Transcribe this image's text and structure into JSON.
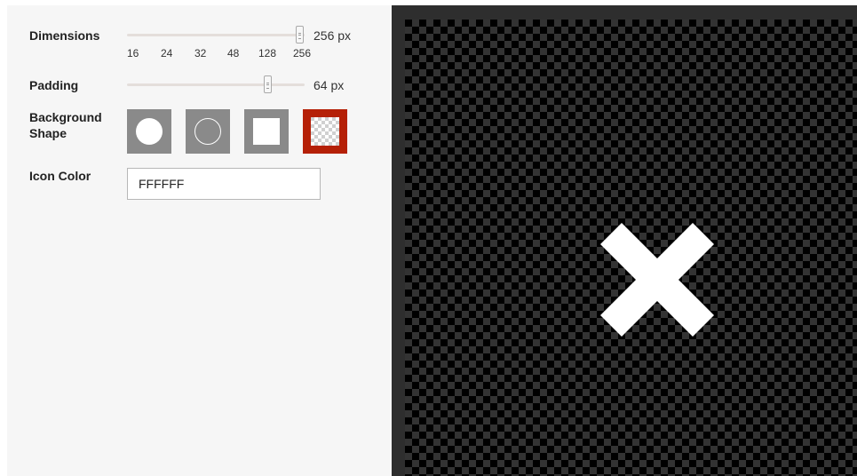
{
  "dimensions": {
    "label": "Dimensions",
    "value_text": "256 px",
    "ticks": [
      "16",
      "24",
      "32",
      "48",
      "128",
      "256"
    ],
    "selected_index": 5
  },
  "padding": {
    "label": "Padding",
    "value_text": "64 px",
    "fraction": 0.79
  },
  "background_shape": {
    "label": "Background Shape",
    "options": [
      {
        "name": "filled-circle",
        "selected": false
      },
      {
        "name": "outline-circle",
        "selected": false
      },
      {
        "name": "filled-square",
        "selected": false
      },
      {
        "name": "transparent",
        "selected": true
      }
    ]
  },
  "icon_color": {
    "label": "Icon Color",
    "value": "FFFFFF"
  },
  "preview": {
    "icon": "close-x-icon",
    "icon_color": "#FFFFFF"
  },
  "colors": {
    "accent": "#B52007",
    "shape_button": "#8A8A8A"
  }
}
